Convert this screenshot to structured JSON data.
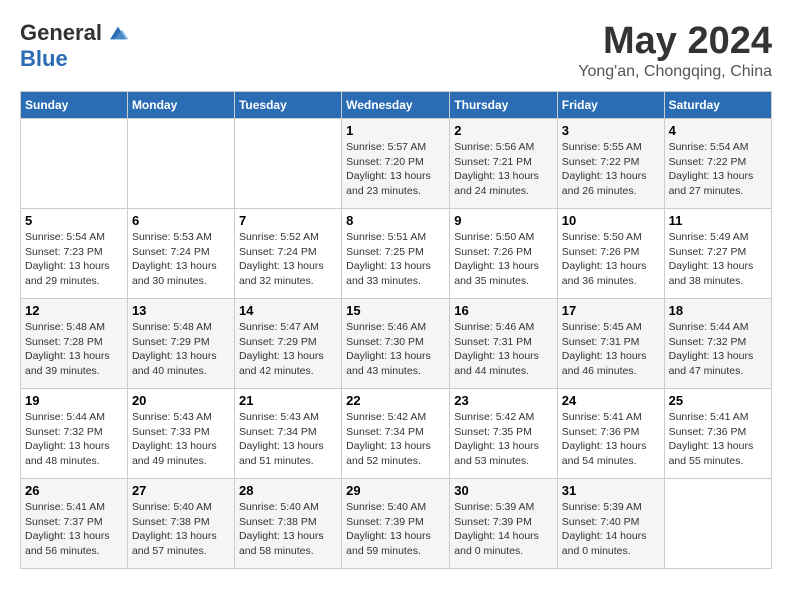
{
  "logo": {
    "general": "General",
    "blue": "Blue"
  },
  "title": "May 2024",
  "subtitle": "Yong'an, Chongqing, China",
  "days_of_week": [
    "Sunday",
    "Monday",
    "Tuesday",
    "Wednesday",
    "Thursday",
    "Friday",
    "Saturday"
  ],
  "weeks": [
    [
      {
        "day": "",
        "info": ""
      },
      {
        "day": "",
        "info": ""
      },
      {
        "day": "",
        "info": ""
      },
      {
        "day": "1",
        "info": "Sunrise: 5:57 AM\nSunset: 7:20 PM\nDaylight: 13 hours\nand 23 minutes."
      },
      {
        "day": "2",
        "info": "Sunrise: 5:56 AM\nSunset: 7:21 PM\nDaylight: 13 hours\nand 24 minutes."
      },
      {
        "day": "3",
        "info": "Sunrise: 5:55 AM\nSunset: 7:22 PM\nDaylight: 13 hours\nand 26 minutes."
      },
      {
        "day": "4",
        "info": "Sunrise: 5:54 AM\nSunset: 7:22 PM\nDaylight: 13 hours\nand 27 minutes."
      }
    ],
    [
      {
        "day": "5",
        "info": "Sunrise: 5:54 AM\nSunset: 7:23 PM\nDaylight: 13 hours\nand 29 minutes."
      },
      {
        "day": "6",
        "info": "Sunrise: 5:53 AM\nSunset: 7:24 PM\nDaylight: 13 hours\nand 30 minutes."
      },
      {
        "day": "7",
        "info": "Sunrise: 5:52 AM\nSunset: 7:24 PM\nDaylight: 13 hours\nand 32 minutes."
      },
      {
        "day": "8",
        "info": "Sunrise: 5:51 AM\nSunset: 7:25 PM\nDaylight: 13 hours\nand 33 minutes."
      },
      {
        "day": "9",
        "info": "Sunrise: 5:50 AM\nSunset: 7:26 PM\nDaylight: 13 hours\nand 35 minutes."
      },
      {
        "day": "10",
        "info": "Sunrise: 5:50 AM\nSunset: 7:26 PM\nDaylight: 13 hours\nand 36 minutes."
      },
      {
        "day": "11",
        "info": "Sunrise: 5:49 AM\nSunset: 7:27 PM\nDaylight: 13 hours\nand 38 minutes."
      }
    ],
    [
      {
        "day": "12",
        "info": "Sunrise: 5:48 AM\nSunset: 7:28 PM\nDaylight: 13 hours\nand 39 minutes."
      },
      {
        "day": "13",
        "info": "Sunrise: 5:48 AM\nSunset: 7:29 PM\nDaylight: 13 hours\nand 40 minutes."
      },
      {
        "day": "14",
        "info": "Sunrise: 5:47 AM\nSunset: 7:29 PM\nDaylight: 13 hours\nand 42 minutes."
      },
      {
        "day": "15",
        "info": "Sunrise: 5:46 AM\nSunset: 7:30 PM\nDaylight: 13 hours\nand 43 minutes."
      },
      {
        "day": "16",
        "info": "Sunrise: 5:46 AM\nSunset: 7:31 PM\nDaylight: 13 hours\nand 44 minutes."
      },
      {
        "day": "17",
        "info": "Sunrise: 5:45 AM\nSunset: 7:31 PM\nDaylight: 13 hours\nand 46 minutes."
      },
      {
        "day": "18",
        "info": "Sunrise: 5:44 AM\nSunset: 7:32 PM\nDaylight: 13 hours\nand 47 minutes."
      }
    ],
    [
      {
        "day": "19",
        "info": "Sunrise: 5:44 AM\nSunset: 7:32 PM\nDaylight: 13 hours\nand 48 minutes."
      },
      {
        "day": "20",
        "info": "Sunrise: 5:43 AM\nSunset: 7:33 PM\nDaylight: 13 hours\nand 49 minutes."
      },
      {
        "day": "21",
        "info": "Sunrise: 5:43 AM\nSunset: 7:34 PM\nDaylight: 13 hours\nand 51 minutes."
      },
      {
        "day": "22",
        "info": "Sunrise: 5:42 AM\nSunset: 7:34 PM\nDaylight: 13 hours\nand 52 minutes."
      },
      {
        "day": "23",
        "info": "Sunrise: 5:42 AM\nSunset: 7:35 PM\nDaylight: 13 hours\nand 53 minutes."
      },
      {
        "day": "24",
        "info": "Sunrise: 5:41 AM\nSunset: 7:36 PM\nDaylight: 13 hours\nand 54 minutes."
      },
      {
        "day": "25",
        "info": "Sunrise: 5:41 AM\nSunset: 7:36 PM\nDaylight: 13 hours\nand 55 minutes."
      }
    ],
    [
      {
        "day": "26",
        "info": "Sunrise: 5:41 AM\nSunset: 7:37 PM\nDaylight: 13 hours\nand 56 minutes."
      },
      {
        "day": "27",
        "info": "Sunrise: 5:40 AM\nSunset: 7:38 PM\nDaylight: 13 hours\nand 57 minutes."
      },
      {
        "day": "28",
        "info": "Sunrise: 5:40 AM\nSunset: 7:38 PM\nDaylight: 13 hours\nand 58 minutes."
      },
      {
        "day": "29",
        "info": "Sunrise: 5:40 AM\nSunset: 7:39 PM\nDaylight: 13 hours\nand 59 minutes."
      },
      {
        "day": "30",
        "info": "Sunrise: 5:39 AM\nSunset: 7:39 PM\nDaylight: 14 hours\nand 0 minutes."
      },
      {
        "day": "31",
        "info": "Sunrise: 5:39 AM\nSunset: 7:40 PM\nDaylight: 14 hours\nand 0 minutes."
      },
      {
        "day": "",
        "info": ""
      }
    ]
  ]
}
